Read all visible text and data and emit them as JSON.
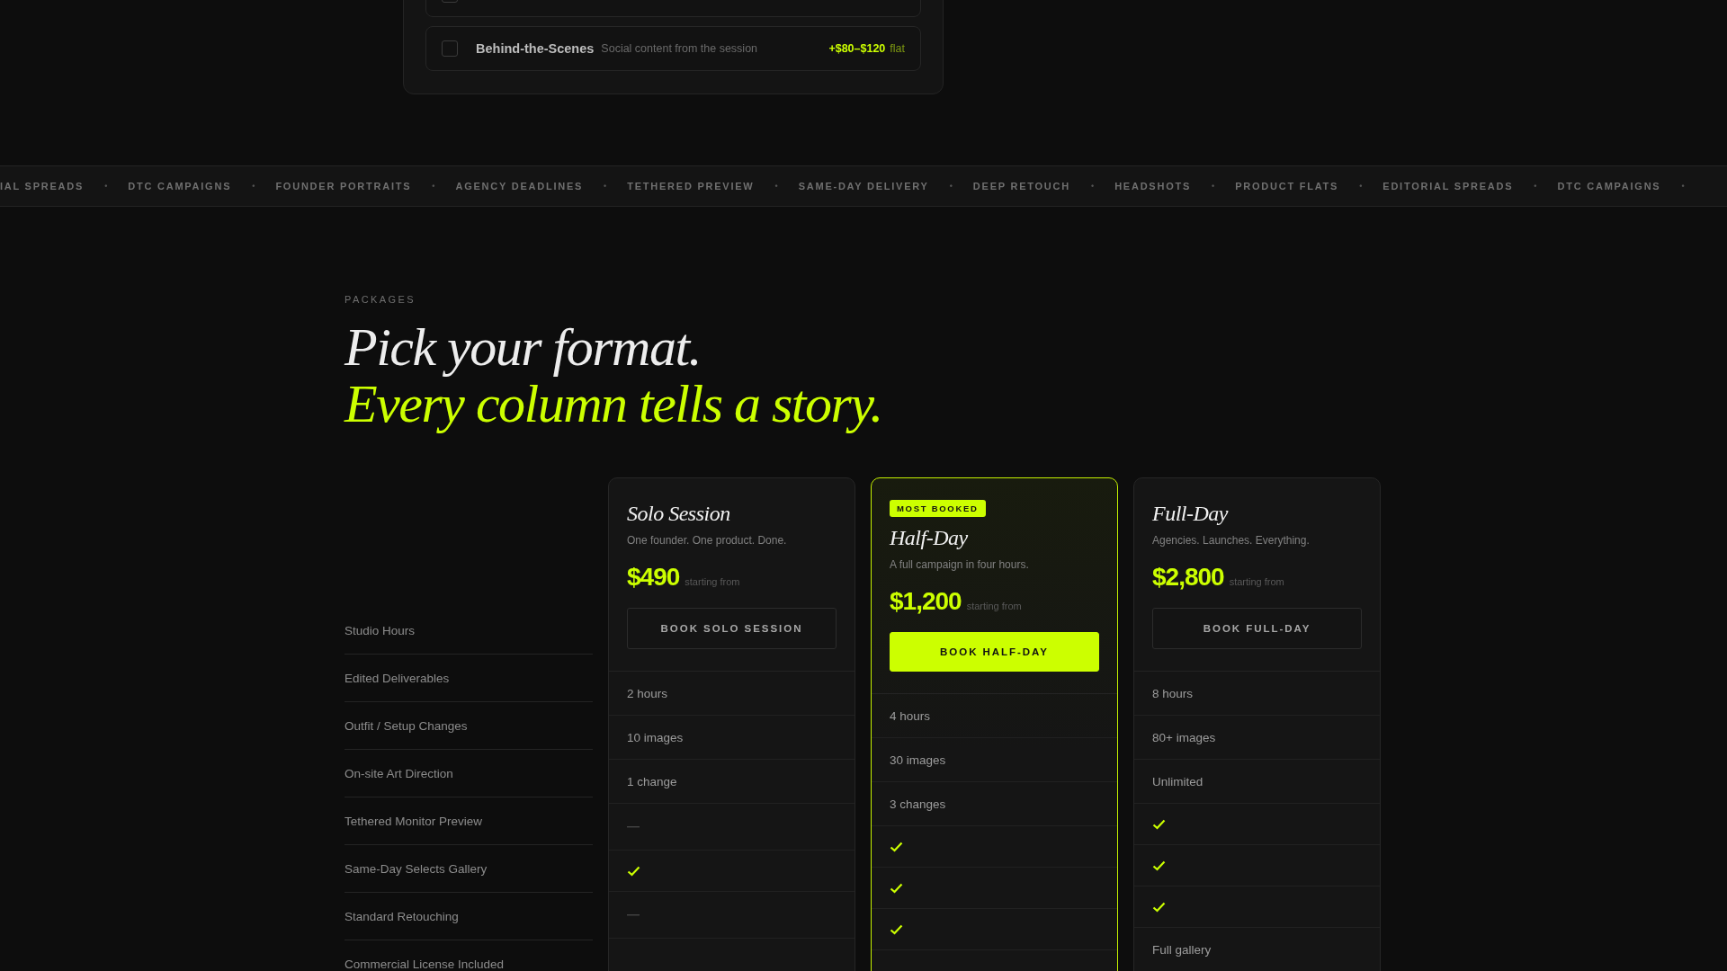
{
  "addons": [
    {
      "checked": false
    },
    {
      "checked": false,
      "name": "Behind-the-Scenes",
      "description": "Social content from the session",
      "price": "+$80–$120",
      "price_note": "flat"
    }
  ],
  "marquee": [
    "IAL SPREADS",
    "•",
    "DTC CAMPAIGNS",
    "•",
    "FOUNDER PORTRAITS",
    "•",
    "AGENCY DEADLINES",
    "•",
    "TETHERED PREVIEW",
    "•",
    "SAME-DAY DELIVERY",
    "•",
    "DEEP RETOUCH",
    "•",
    "HEADSHOTS",
    "•",
    "PRODUCT FLATS",
    "•",
    "EDITORIAL SPREADS",
    "•",
    "DTC CAMPAIGNS",
    "•"
  ],
  "packages": {
    "eyebrow": "PACKAGES",
    "heading": [
      "Pick your format.",
      "Every column tells a story."
    ],
    "features": [
      "Studio Hours",
      "Edited Deliverables",
      "Outfit / Setup Changes",
      "On-site Art Direction",
      "Tethered Monitor Preview",
      "Same-Day Selects Gallery",
      "Standard Retouching",
      "Commercial License Included"
    ],
    "plans": [
      {
        "name": "Solo Session",
        "tagline": "One founder. One product. Done.",
        "price": "$490",
        "price_note": "starting from",
        "button": "BOOK SOLO SESSION",
        "featured": false,
        "cells": [
          {
            "kind": "text",
            "text": "2 hours"
          },
          {
            "kind": "text",
            "text": "10 images"
          },
          {
            "kind": "text",
            "text": "1 change"
          },
          {
            "kind": "none"
          },
          {
            "kind": "check"
          },
          {
            "kind": "none"
          },
          {
            "kind": "empty"
          }
        ]
      },
      {
        "name": "Half-Day",
        "tagline": "A full campaign in four hours.",
        "price": "$1,200",
        "price_note": "starting from",
        "button": "BOOK HALF-DAY",
        "featured": true,
        "badge": "MOST BOOKED",
        "cells": [
          {
            "kind": "text",
            "text": "4 hours"
          },
          {
            "kind": "text",
            "text": "30 images"
          },
          {
            "kind": "text",
            "text": "3 changes"
          },
          {
            "kind": "check"
          },
          {
            "kind": "check"
          },
          {
            "kind": "check"
          },
          {
            "kind": "empty"
          }
        ]
      },
      {
        "name": "Full-Day",
        "tagline": "Agencies. Launches. Everything.",
        "price": "$2,800",
        "price_note": "starting from",
        "button": "BOOK FULL-DAY",
        "featured": false,
        "cells": [
          {
            "kind": "text",
            "text": "8 hours"
          },
          {
            "kind": "text",
            "text": "80+ images"
          },
          {
            "kind": "text",
            "text": "Unlimited"
          },
          {
            "kind": "check"
          },
          {
            "kind": "check"
          },
          {
            "kind": "check"
          },
          {
            "kind": "text",
            "text": "Full gallery"
          }
        ]
      }
    ]
  }
}
